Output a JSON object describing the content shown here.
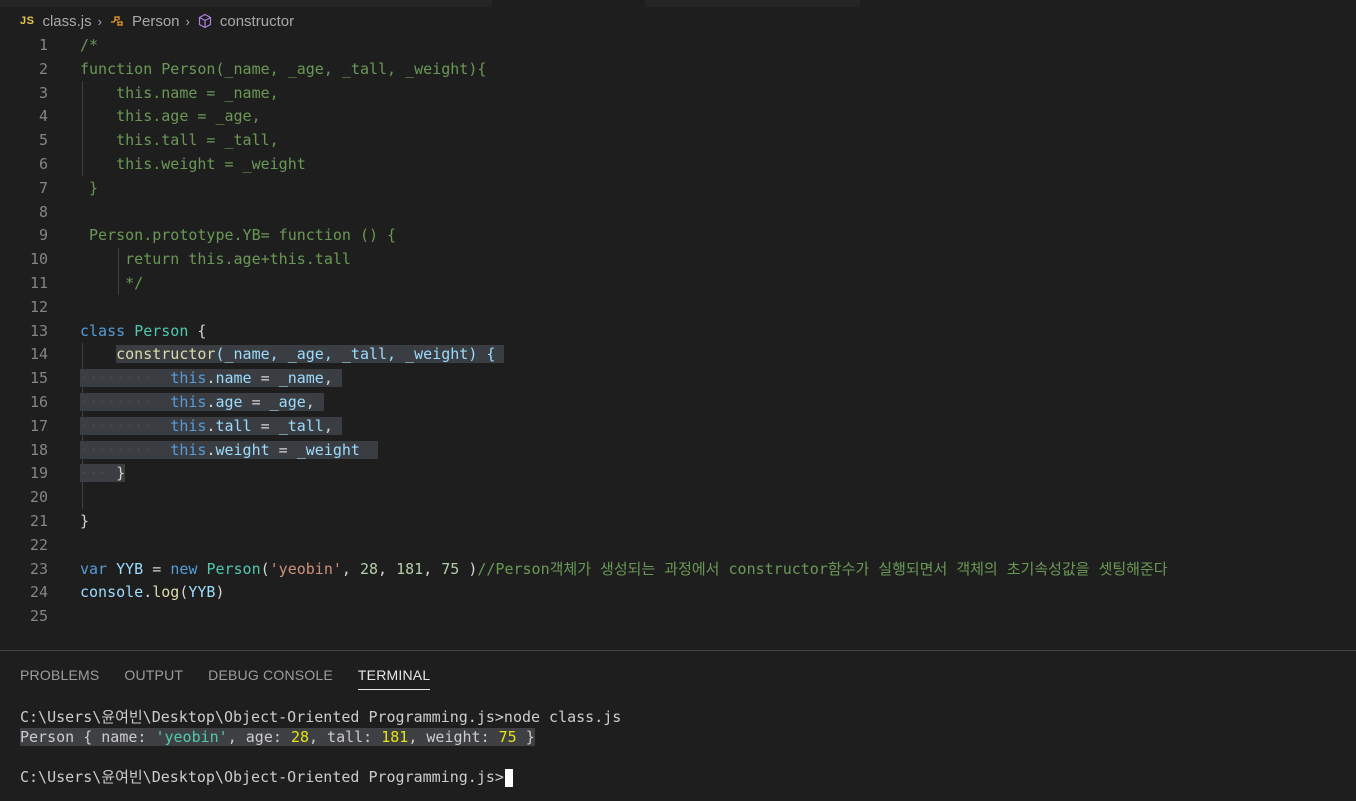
{
  "breadcrumb": {
    "file_badge": "JS",
    "file": "class.js",
    "class": "Person",
    "method": "constructor"
  },
  "editor": {
    "line_numbers": [
      "1",
      "2",
      "3",
      "4",
      "5",
      "6",
      "7",
      "8",
      "9",
      "10",
      "11",
      "12",
      "13",
      "14",
      "15",
      "16",
      "17",
      "18",
      "19",
      "20",
      "21",
      "22",
      "23",
      "24",
      "25"
    ],
    "code": {
      "l1": "/*",
      "l2": "function Person(_name, _age, _tall, _weight){",
      "l3": "    this.name = _name,",
      "l4": "    this.age = _age,",
      "l5": "    this.tall = _tall,",
      "l6": "    this.weight = _weight",
      "l7": " }",
      "l8": "",
      "l9": " Person.prototype.YB= function () {",
      "l10": "     return this.age+this.tall",
      "l11": "     */",
      "l12": "",
      "l13_kw": "class",
      "l13_name": "Person",
      "l13_brace": " {",
      "l14_fn": "constructor",
      "l14_rest": "(_name, _age, _tall, _weight) {",
      "l15_prop": "name",
      "l15_val": "_name",
      "l16_prop": "age",
      "l16_val": "_age",
      "l17_prop": "tall",
      "l17_val": "_tall",
      "l18_prop": "weight",
      "l18_val": "_weight",
      "this": "this",
      "l19": "}",
      "l21": "}",
      "l23_var": "var",
      "l23_name": "YYB",
      "l23_new": "new",
      "l23_cls": "Person",
      "l23_str": "'yeobin'",
      "l23_n1": "28",
      "l23_n2": "181",
      "l23_n3": "75",
      "l23_comment": "//Person객체가 생성되는 과정에서 constructor함수가 실행되면서 객체의 초기속성값을 셋팅해준다",
      "l24_obj": "console",
      "l24_fn": "log",
      "l24_arg": "YYB"
    }
  },
  "panel": {
    "tabs": [
      "PROBLEMS",
      "OUTPUT",
      "DEBUG CONSOLE",
      "TERMINAL"
    ],
    "active_tab": "TERMINAL",
    "terminal": {
      "prompt1": "C:\\Users\\윤여빈\\Desktop\\Object-Oriented Programming.js>node class.js",
      "out_prefix": "Person { name: ",
      "out_name": "'yeobin'",
      "out_age_label": ", age: ",
      "out_age": "28",
      "out_tall_label": ", tall: ",
      "out_tall": "181",
      "out_weight_label": ", weight: ",
      "out_weight": "75",
      "out_suffix": " }",
      "prompt2": "C:\\Users\\윤여빈\\Desktop\\Object-Oriented Programming.js>"
    }
  },
  "colors": {
    "background": "#1e1e1e",
    "comment": "#6a9955",
    "keyword": "#569cd6",
    "class": "#4ec9b0",
    "function": "#dcdcaa",
    "variable": "#9cdcfe",
    "string": "#ce9178",
    "number": "#b5cea8",
    "selection": "#3a3d41"
  },
  "icons": {
    "breadcrumb_class": "symbol-class-icon",
    "breadcrumb_method": "symbol-method-icon"
  }
}
